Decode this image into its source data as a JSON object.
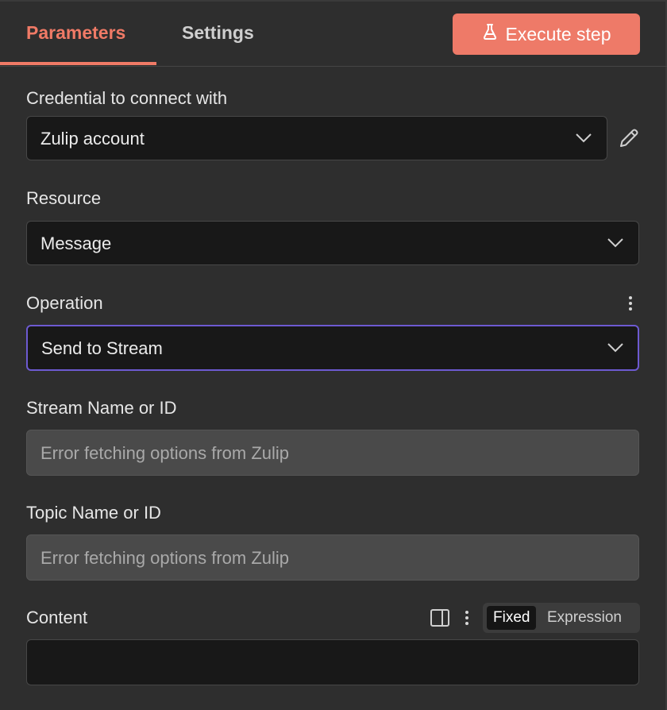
{
  "tabs": [
    {
      "label": "Parameters",
      "active": true
    },
    {
      "label": "Settings",
      "active": false
    }
  ],
  "execute_button": {
    "label": "Execute step",
    "icon": "flask-icon",
    "color": "#ee7a68"
  },
  "accent_color": "#f07a66",
  "focus_color": "#6d5ad1",
  "credential": {
    "label": "Credential to connect with",
    "value": "Zulip account"
  },
  "resource": {
    "label": "Resource",
    "value": "Message"
  },
  "operation": {
    "label": "Operation",
    "value": "Send to Stream"
  },
  "stream": {
    "label": "Stream Name or ID",
    "value": "Error fetching options from Zulip"
  },
  "topic": {
    "label": "Topic Name or ID",
    "value": "Error fetching options from Zulip"
  },
  "content": {
    "label": "Content",
    "value": "",
    "mode_options": [
      "Fixed",
      "Expression"
    ],
    "selected_mode": "Fixed"
  }
}
